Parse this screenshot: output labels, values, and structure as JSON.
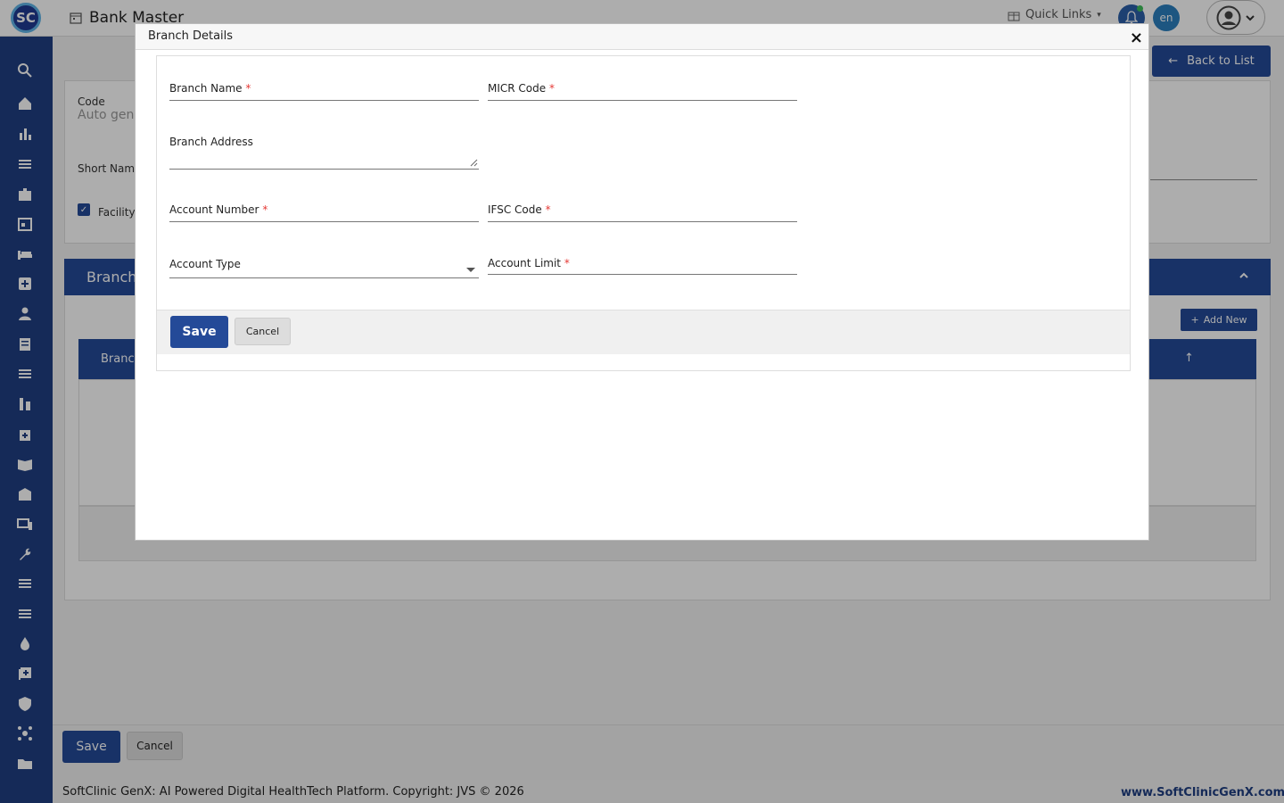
{
  "app": {
    "logo_text": "SC",
    "page_title": "Bank Master",
    "quick_links": "Quick Links",
    "language": "en",
    "back_to_list": "Back to List"
  },
  "sidebar": {
    "icons": [
      "search-icon",
      "home-icon",
      "bar-chart-icon",
      "menu-icon",
      "badge-icon",
      "calendar-icon",
      "bed-icon",
      "medical-plus-icon",
      "person-icon",
      "document-icon",
      "list-icon",
      "lab-icon",
      "medicine-box-icon",
      "book-icon",
      "building-icon",
      "devices-icon",
      "wrench-icon",
      "list-icon",
      "list-icon",
      "drop-icon",
      "add-box-icon",
      "shield-icon",
      "network-icon",
      "folder-icon"
    ]
  },
  "background_form": {
    "code_label": "Code",
    "code_value": "Auto gen",
    "short_name_label": "Short Name",
    "facility_label": "Facility",
    "branch_section_title": "Branch",
    "add_new": "Add New",
    "table_header_first": "Branch"
  },
  "footer": {
    "save": "Save",
    "cancel": "Cancel",
    "copyright": "SoftClinic GenX: AI Powered Digital HealthTech Platform. Copyright: JVS © 2026",
    "website": "www.SoftClinicGenX.com"
  },
  "modal": {
    "title": "Branch Details",
    "close": "×",
    "fields": {
      "branch_name": {
        "label": "Branch Name",
        "required": "*",
        "value": ""
      },
      "micr_code": {
        "label": "MICR Code",
        "required": "*",
        "value": ""
      },
      "branch_address": {
        "label": "Branch Address",
        "value": ""
      },
      "account_number": {
        "label": "Account Number",
        "required": "*",
        "value": ""
      },
      "ifsc_code": {
        "label": "IFSC Code",
        "required": "*",
        "value": ""
      },
      "account_type": {
        "label": "Account Type",
        "value": ""
      },
      "account_limit": {
        "label": "Account Limit",
        "required": "*",
        "value": ""
      }
    },
    "save": "Save",
    "cancel": "Cancel"
  },
  "colors": {
    "primary": "#244a98",
    "sidebar": "#1f3f82",
    "required": "#e53935",
    "notification_dot": "#3fbf5a"
  }
}
